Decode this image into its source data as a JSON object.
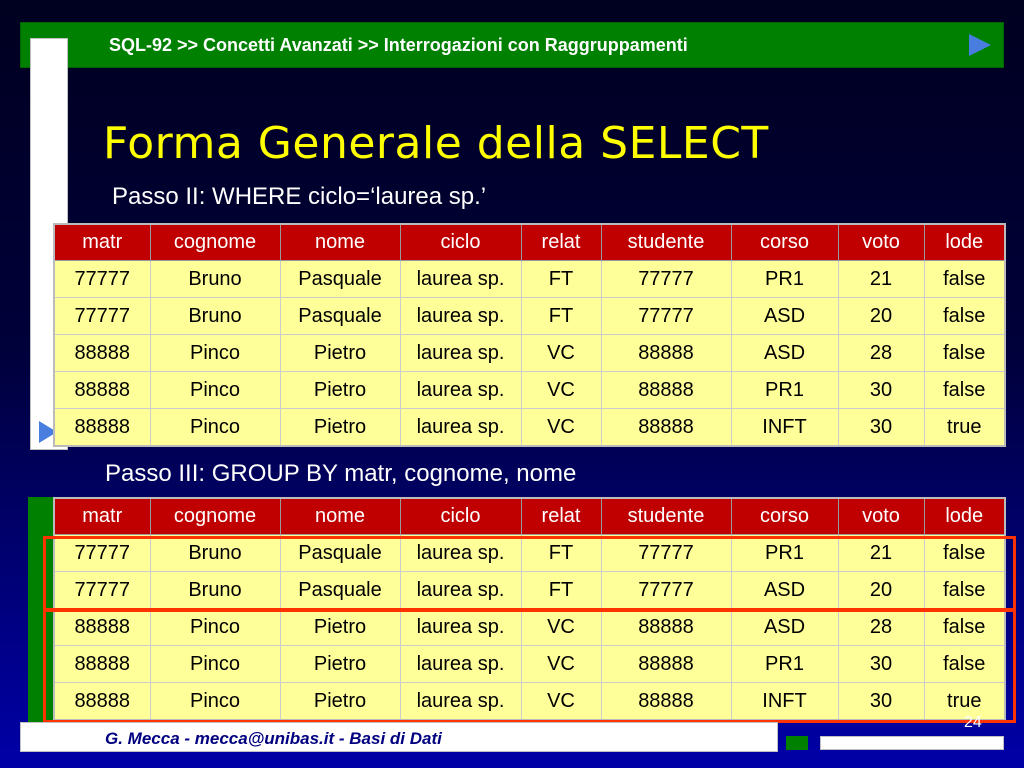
{
  "header": {
    "text": "SQL-92 >> Concetti Avanzati >> Interrogazioni con Raggruppamenti",
    "arrow_icon": "play-arrow-icon"
  },
  "title": "Forma Generale della SELECT",
  "step2": {
    "label": "Passo II: WHERE ciclo=‘laurea sp.’"
  },
  "step3": {
    "label": "Passo III: GROUP BY matr, cognome, nome"
  },
  "table_columns": [
    "matr",
    "cognome",
    "nome",
    "ciclo",
    "relat",
    "studente",
    "corso",
    "voto",
    "lode"
  ],
  "table_rows": [
    [
      "77777",
      "Bruno",
      "Pasquale",
      "laurea sp.",
      "FT",
      "77777",
      "PR1",
      "21",
      "false"
    ],
    [
      "77777",
      "Bruno",
      "Pasquale",
      "laurea sp.",
      "FT",
      "77777",
      "ASD",
      "20",
      "false"
    ],
    [
      "88888",
      "Pinco",
      "Pietro",
      "laurea sp.",
      "VC",
      "88888",
      "ASD",
      "28",
      "false"
    ],
    [
      "88888",
      "Pinco",
      "Pietro",
      "laurea sp.",
      "VC",
      "88888",
      "PR1",
      "30",
      "false"
    ],
    [
      "88888",
      "Pinco",
      "Pietro",
      "laurea sp.",
      "VC",
      "88888",
      "INFT",
      "30",
      "true"
    ]
  ],
  "footer": {
    "text": "G. Mecca - mecca@unibas.it - Basi di Dati",
    "page_number": "24"
  },
  "colors": {
    "header_bar": "#008000",
    "title": "#ffff00",
    "table_header": "#c00000",
    "table_body": "#ffff99",
    "group_highlight": "#ff3300"
  }
}
